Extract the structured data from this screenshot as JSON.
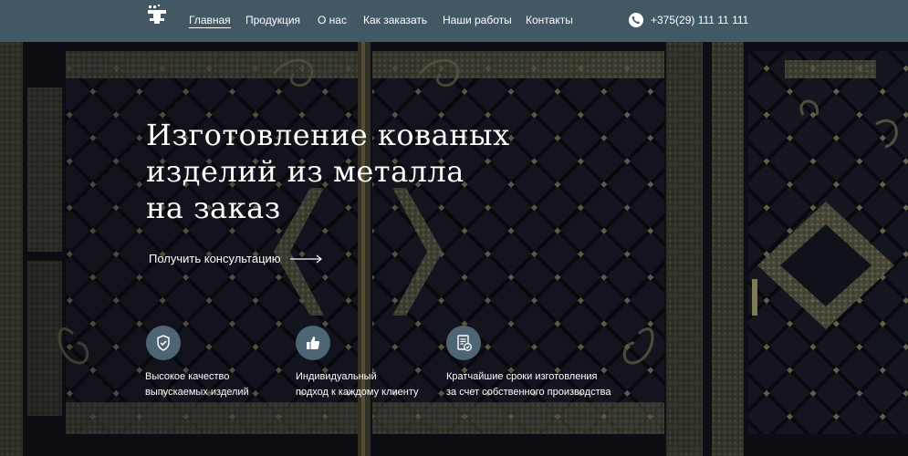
{
  "header": {
    "logo_icon": "anvil-logo-icon",
    "nav": [
      {
        "label": "Главная",
        "active": true
      },
      {
        "label": "Продукция",
        "active": false
      },
      {
        "label": "О нас",
        "active": false
      },
      {
        "label": "Как заказать",
        "active": false
      },
      {
        "label": "Наши работы",
        "active": false
      },
      {
        "label": "Контакты",
        "active": false
      }
    ],
    "phone": {
      "icon": "phone-icon",
      "number": "+375(29)  111 11 111"
    }
  },
  "hero": {
    "title_lines": [
      "Изготовление кованых",
      "изделий из металла",
      "на заказ"
    ],
    "cta_label": "Получить консультацию",
    "cta_icon": "arrow-right-icon"
  },
  "features": [
    {
      "icon": "shield-check-icon",
      "line1": "Высокое качество",
      "line2": "выпускаемых изделий"
    },
    {
      "icon": "thumbs-up-icon",
      "line1": "Индивидуальный",
      "line2": "подход к каждому клиенту"
    },
    {
      "icon": "document-check-icon",
      "line1": "Кратчайшие сроки изготовления",
      "line2": "за счет собственного производства"
    }
  ],
  "colors": {
    "header_bg": "#435865",
    "icon_circle": "#4d6574",
    "text": "#ffffff",
    "iron": "#0e0f17",
    "bronze": "#6b6650"
  }
}
